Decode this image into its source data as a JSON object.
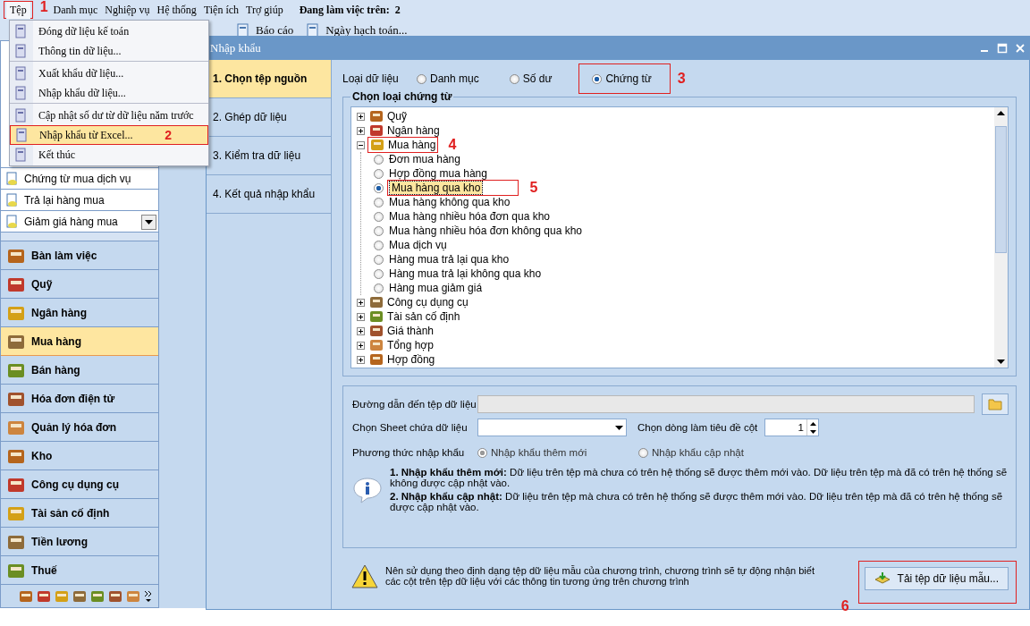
{
  "menu_bar": {
    "items": [
      {
        "label": "Tệp",
        "selected": true,
        "annotation": "1"
      },
      {
        "label": "Danh mục",
        "selected": false
      },
      {
        "label": "Nghiệp vụ",
        "selected": false
      },
      {
        "label": "Hệ thống",
        "selected": false
      },
      {
        "label": "Tiện ích",
        "selected": false
      },
      {
        "label": "Trợ giúp",
        "selected": false
      }
    ],
    "workspace": {
      "label": "Đang làm việc trên:",
      "value": "2"
    }
  },
  "toolbar": [
    {
      "label": "Báo cáo"
    },
    {
      "label": "Ngày hạch toán..."
    }
  ],
  "file_menu": [
    {
      "label": "Đóng dữ liệu kế toán",
      "selected": false,
      "separator_after": false
    },
    {
      "label": "Thông tin dữ liệu...",
      "selected": false,
      "separator_after": true
    },
    {
      "label": "Xuất khẩu dữ liệu...",
      "selected": false,
      "separator_after": false
    },
    {
      "label": "Nhập khẩu dữ liệu...",
      "selected": false,
      "separator_after": true
    },
    {
      "label": "Cập nhật số dư từ dữ liệu năm trước",
      "selected": false,
      "separator_after": false
    },
    {
      "label": "Nhập khẩu từ Excel...",
      "selected": true,
      "separator_after": false,
      "annotation": "2"
    },
    {
      "label": "Kết thúc",
      "selected": false,
      "separator_after": false
    }
  ],
  "sidebar": {
    "list": [
      {
        "label": "Chứng từ mua dịch vụ"
      },
      {
        "label": "Trả lại hàng mua"
      },
      {
        "label": "Giảm giá hàng mua"
      }
    ],
    "modules": [
      {
        "label": "Bàn làm việc",
        "selected": false
      },
      {
        "label": "Quỹ",
        "selected": false
      },
      {
        "label": "Ngân hàng",
        "selected": false
      },
      {
        "label": "Mua hàng",
        "selected": true
      },
      {
        "label": "Bán hàng",
        "selected": false
      },
      {
        "label": "Hóa đơn điện tử",
        "selected": false
      },
      {
        "label": "Quản lý hóa đơn",
        "selected": false
      },
      {
        "label": "Kho",
        "selected": false
      },
      {
        "label": "Công cụ dụng cụ",
        "selected": false
      },
      {
        "label": "Tài sản cố định",
        "selected": false
      },
      {
        "label": "Tiền lương",
        "selected": false
      },
      {
        "label": "Thuế",
        "selected": false
      }
    ]
  },
  "dialog": {
    "title": "Nhập khẩu",
    "steps": [
      {
        "label": "1. Chọn tệp nguồn",
        "selected": true
      },
      {
        "label": "2. Ghép dữ liệu",
        "selected": false
      },
      {
        "label": "3. Kiểm tra dữ liệu",
        "selected": false
      },
      {
        "label": "4. Kết quả nhập khẩu",
        "selected": false
      }
    ],
    "data_type": {
      "label": "Loại dữ liệu",
      "options": [
        {
          "label": "Danh mục",
          "selected": false
        },
        {
          "label": "Số dư",
          "selected": false
        },
        {
          "label": "Chứng từ",
          "selected": true,
          "annotation": "3"
        }
      ]
    },
    "voucher_group": {
      "title": "Chọn loại chứng từ",
      "tree": [
        {
          "label": "Quỹ",
          "expanded": false
        },
        {
          "label": "Ngân hàng",
          "expanded": false
        },
        {
          "label": "Mua hàng",
          "expanded": true,
          "annotation": "4",
          "children": [
            {
              "label": "Đơn mua hàng",
              "selected": false
            },
            {
              "label": "Hợp đồng mua hàng",
              "selected": false
            },
            {
              "label": "Mua hàng qua kho",
              "selected": true,
              "annotation": "5"
            },
            {
              "label": "Mua hàng không qua kho",
              "selected": false
            },
            {
              "label": "Mua hàng nhiều hóa đơn qua kho",
              "selected": false
            },
            {
              "label": "Mua hàng nhiều hóa đơn không qua kho",
              "selected": false
            },
            {
              "label": "Mua dịch vụ",
              "selected": false
            },
            {
              "label": "Hàng mua trả lại qua kho",
              "selected": false
            },
            {
              "label": "Hàng mua trả lại không qua kho",
              "selected": false
            },
            {
              "label": "Hàng mua giảm giá",
              "selected": false
            }
          ]
        },
        {
          "label": "Công cụ dụng cụ",
          "expanded": false
        },
        {
          "label": "Tài sản cố định",
          "expanded": false
        },
        {
          "label": "Giá thành",
          "expanded": false
        },
        {
          "label": "Tổng hợp",
          "expanded": false
        },
        {
          "label": "Hợp đồng",
          "expanded": false
        }
      ]
    },
    "file_path": {
      "label": "Đường dẫn đến tệp dữ liệu"
    },
    "sheet": {
      "label": "Chọn Sheet chứa dữ liệu"
    },
    "header_row": {
      "label": "Chọn dòng làm tiêu đề cột",
      "value": "1"
    },
    "import_method": {
      "label": "Phương thức nhập khẩu",
      "options": [
        {
          "label": "Nhập khẩu thêm mới",
          "selected": true
        },
        {
          "label": "Nhập khẩu cập nhật",
          "selected": false
        }
      ]
    },
    "notes": [
      "**1. Nhập khẩu thêm mới:** Dữ liệu trên tệp mà chưa có trên hệ thống sẽ được thêm mới vào. Dữ liệu trên tệp mà đã có trên hệ thống sẽ không được cập nhật vào.",
      "**2. Nhập khẩu cập nhật:** Dữ liệu trên tệp mà chưa có trên hệ thống sẽ được thêm mới vào. Dữ liệu trên tệp mà đã có trên hệ thống sẽ được cập nhật vào."
    ],
    "warning": "Nên sử dụng theo định dạng tệp dữ liệu mẫu của chương trình, chương trình sẽ tự động nhận biết các cột trên tệp dữ liệu với các thông tin tương ứng trên chương trình",
    "download_button": {
      "label": "Tải tệp dữ liệu mẫu...",
      "annotation": "6"
    }
  }
}
